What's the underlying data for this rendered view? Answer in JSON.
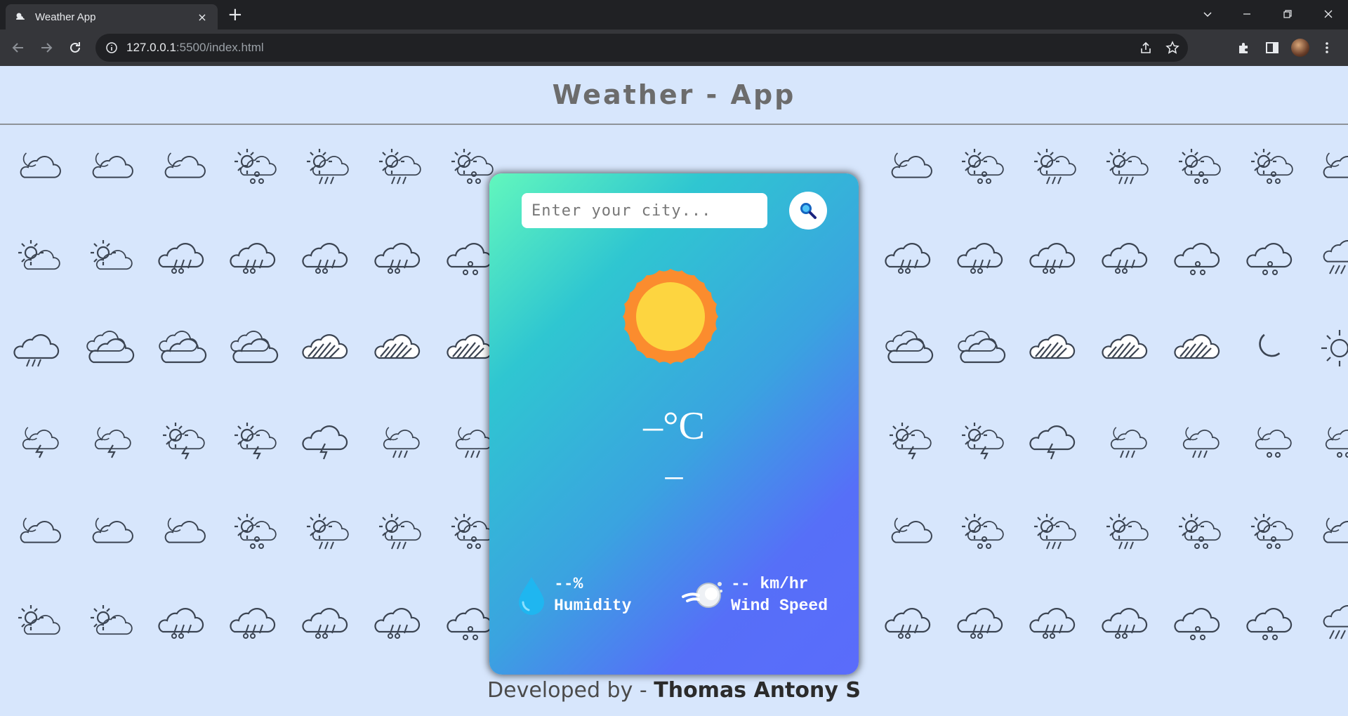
{
  "browser": {
    "tab_title": "Weather App",
    "tab_close": "×",
    "new_tab": "+",
    "url_host": "127.0.0.1",
    "url_path": ":5500/index.html"
  },
  "header": {
    "title": "Weather - App"
  },
  "search": {
    "placeholder": "Enter your city..."
  },
  "weather": {
    "icon": "sun-icon",
    "temperature": "–°C",
    "city": "–"
  },
  "humidity": {
    "value": "--%",
    "label": "Humidity",
    "icon": "water-drop-icon"
  },
  "wind": {
    "value": "-- km/hr",
    "label": "Wind Speed",
    "icon": "wind-icon"
  },
  "footer": {
    "prefix": "Developed by - ",
    "author": "Thomas Antony S"
  },
  "colors": {
    "page_bg": "#d7e6fc",
    "card_gradient_start": "#62f7bd",
    "card_gradient_end": "#5a6cfb",
    "icon_stroke": "#3b4452"
  }
}
